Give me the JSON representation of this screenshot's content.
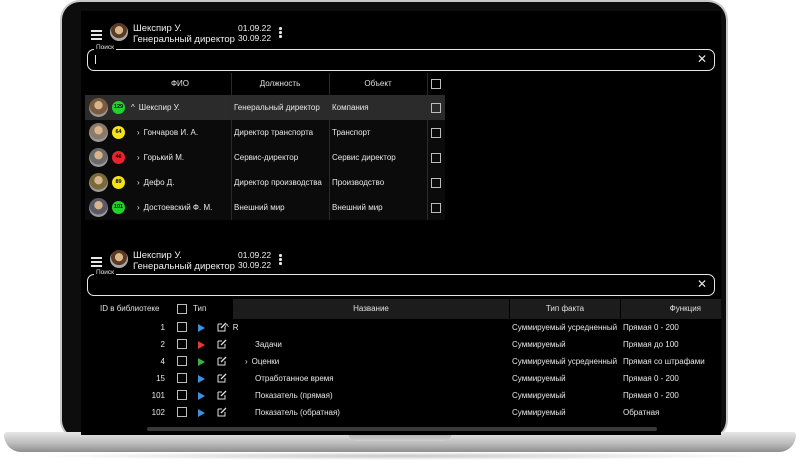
{
  "panel1": {
    "header": {
      "user_name": "Шекспир У.",
      "user_role": "Генеральный директор",
      "date_from": "01.09.22",
      "date_to": "30.09.22"
    },
    "search": {
      "label": "Поиск",
      "value": ""
    },
    "table": {
      "columns": [
        "ФИО",
        "Должность",
        "Объект"
      ],
      "rows": [
        {
          "score": "129",
          "score_color": "#22d12a",
          "expanded": true,
          "name": "Шекспир У.",
          "position": "Генеральный директор",
          "object": "Компания",
          "selected": true
        },
        {
          "score": "64",
          "score_color": "#f5e317",
          "expanded": false,
          "name": "Гончаров И. А.",
          "position": "Директор транспорта",
          "object": "Транспорт",
          "selected": false
        },
        {
          "score": "46",
          "score_color": "#e8232b",
          "expanded": false,
          "name": "Горький М.",
          "position": "Сервис-директор",
          "object": "Сервис директор",
          "selected": false
        },
        {
          "score": "89",
          "score_color": "#f5e317",
          "expanded": false,
          "name": "Дефо Д.",
          "position": "Директор производства",
          "object": "Производство",
          "selected": false
        },
        {
          "score": "101",
          "score_color": "#22d12a",
          "expanded": false,
          "name": "Достоевский Ф. М.",
          "position": "Внешний мир",
          "object": "Внешний мир",
          "selected": false
        }
      ]
    }
  },
  "panel2": {
    "header": {
      "user_name": "Шекспир У.",
      "user_role": "Генеральный директор",
      "date_from": "01.09.22",
      "date_to": "30.09.22"
    },
    "search": {
      "label": "Поиск",
      "value": ""
    },
    "table": {
      "columns": {
        "id": "ID в библиотеке",
        "type": "Тип",
        "name": "Название",
        "fact_type": "Тип факта",
        "function": "Функция"
      },
      "rows": [
        {
          "id": "1",
          "type_color": "#3d8fe0",
          "chevron": "down",
          "indent": 0,
          "name": "R",
          "fact_type": "Суммируемый усредненный",
          "function": "Прямая 0 - 200"
        },
        {
          "id": "2",
          "type_color": "#e23a30",
          "chevron": "",
          "indent": 1,
          "name": "Задачи",
          "fact_type": "Суммируемый",
          "function": "Прямая до 100"
        },
        {
          "id": "4",
          "type_color": "#3cb043",
          "chevron": "right",
          "indent": 1,
          "name": "Оценки",
          "fact_type": "Суммируемый усредненный",
          "function": "Прямая со штрафами"
        },
        {
          "id": "15",
          "type_color": "#3d8fe0",
          "chevron": "",
          "indent": 1,
          "name": "Отработанное время",
          "fact_type": "Суммируемый",
          "function": "Прямая 0 - 200"
        },
        {
          "id": "101",
          "type_color": "#3d8fe0",
          "chevron": "",
          "indent": 1,
          "name": "Показатель (прямая)",
          "fact_type": "Суммируемый",
          "function": "Прямая 0 - 200"
        },
        {
          "id": "102",
          "type_color": "#3d8fe0",
          "chevron": "",
          "indent": 1,
          "name": "Показатель (обратная)",
          "fact_type": "Суммируемый",
          "function": "Обратная"
        }
      ]
    }
  }
}
